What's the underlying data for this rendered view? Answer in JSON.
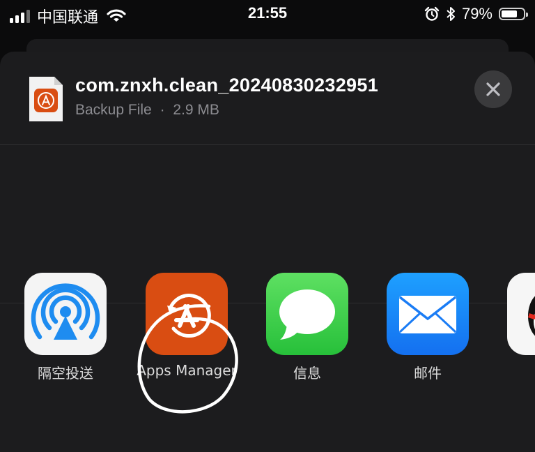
{
  "status_bar": {
    "carrier": "中国联通",
    "time": "21:55",
    "battery_percent": "79%",
    "battery_level": 0.79,
    "signal_bars": 3,
    "signal_bars_total": 4
  },
  "file": {
    "name": "com.znxh.clean_20240830232951",
    "type": "Backup File",
    "separator": "·",
    "size": "2.9 MB",
    "icon": "app-store-restore-icon"
  },
  "close_button": {
    "icon": "close-icon"
  },
  "apps": [
    {
      "label": "隔空投送",
      "icon": "airdrop-icon"
    },
    {
      "label": "Apps Manager",
      "icon": "apps-manager-icon"
    },
    {
      "label": "信息",
      "icon": "messages-icon"
    },
    {
      "label": "邮件",
      "icon": "mail-icon"
    },
    {
      "label": "",
      "icon": "qq-icon"
    }
  ],
  "colors": {
    "sheet_background": "#1c1c1e",
    "apps_manager_orange": "#d94d12",
    "messages_green": "#34c759",
    "mail_blue": "#1a85ff",
    "airdrop_blue": "#1e8cf0"
  }
}
